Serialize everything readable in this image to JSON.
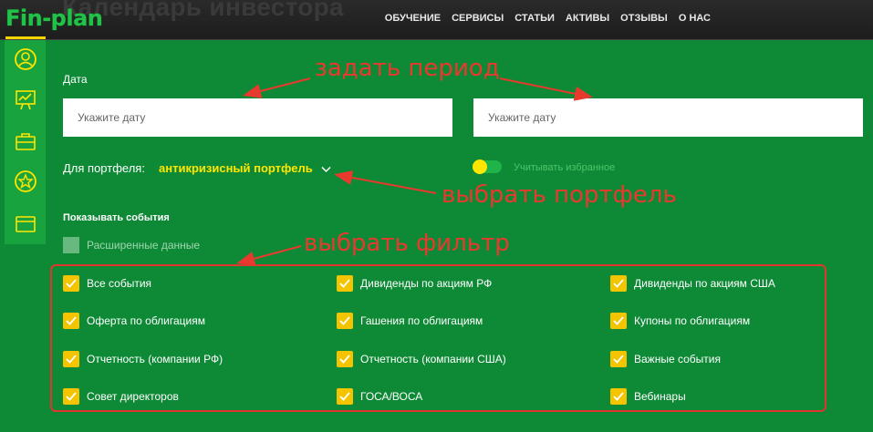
{
  "header": {
    "page_title": "Календарь инвестора",
    "logo": "Fin-plan",
    "nav": [
      "ОБУЧЕНИЕ",
      "СЕРВИСЫ",
      "СТАТЬИ",
      "АКТИВЫ",
      "ОТЗЫВЫ",
      "О НАС"
    ]
  },
  "sidebar": {
    "icons": [
      "user-icon",
      "presentation-icon",
      "briefcase-icon",
      "star-icon",
      "wallet-icon"
    ]
  },
  "form": {
    "date_label": "Дата",
    "date_from_placeholder": "Укажите дату",
    "date_to_placeholder": "Укажите дату",
    "portfolio_label": "Для портфеля:",
    "portfolio_value": "антикризисный портфель",
    "favorites_label": "Учитывать избранное",
    "favorites_on": false,
    "events_title": "Показывать события",
    "extended_label": "Расширенные данные"
  },
  "filters": [
    {
      "label": "Все события",
      "checked": true
    },
    {
      "label": "Дивиденды по акциям РФ",
      "checked": true
    },
    {
      "label": "Дивиденды по акциям США",
      "checked": true
    },
    {
      "label": "Оферта по облигациям",
      "checked": true
    },
    {
      "label": "Гашения по облигациям",
      "checked": true
    },
    {
      "label": "Купоны по облигациям",
      "checked": true
    },
    {
      "label": "Отчетность (компании РФ)",
      "checked": true
    },
    {
      "label": "Отчетность (компании США)",
      "checked": true
    },
    {
      "label": "Важные события",
      "checked": true
    },
    {
      "label": "Совет директоров",
      "checked": true
    },
    {
      "label": "ГОСА/ВОСА",
      "checked": true
    },
    {
      "label": "Вебинары",
      "checked": true
    }
  ],
  "annotations": {
    "period": "задать период",
    "portfolio": "выбрать портфель",
    "filter": "выбрать фильтр"
  },
  "colors": {
    "background": "#0e8a36",
    "accent_yellow": "#ffe600",
    "checkbox": "#f5c400",
    "annotation_red": "#e8392f"
  }
}
